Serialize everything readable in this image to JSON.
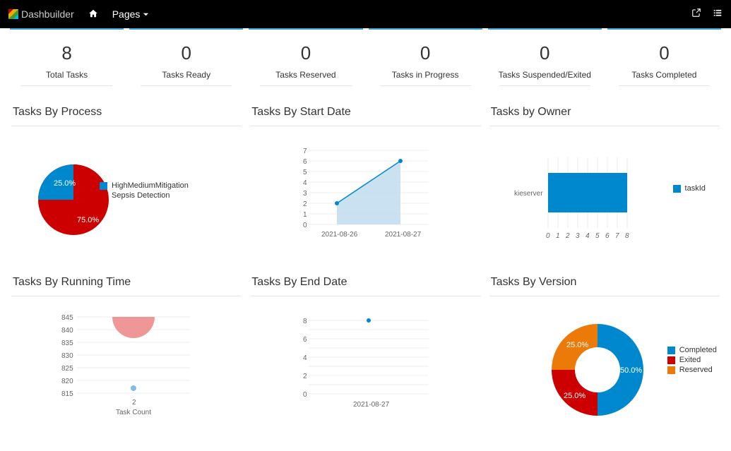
{
  "topbar": {
    "brand": "Dashbuilder",
    "home_icon": "home",
    "pages_label": "Pages",
    "external_icon": "open-external",
    "list_icon": "list"
  },
  "metrics": [
    {
      "value": "8",
      "label": "Total Tasks"
    },
    {
      "value": "0",
      "label": "Tasks Ready"
    },
    {
      "value": "0",
      "label": "Tasks Reserved"
    },
    {
      "value": "0",
      "label": "Tasks in Progress"
    },
    {
      "value": "0",
      "label": "Tasks Suspended/Exited"
    },
    {
      "value": "0",
      "label": "Tasks Completed"
    }
  ],
  "sections": {
    "process": {
      "title": "Tasks By Process",
      "legend": [
        {
          "label": "HighMediumMitigation",
          "color": "#0088ce"
        },
        {
          "label": "Sepsis Detection",
          "color": "#cc0000"
        }
      ],
      "slice1": "25.0%",
      "slice2": "75.0%"
    },
    "startdate": {
      "title": "Tasks By Start Date"
    },
    "owner": {
      "title": "Tasks by Owner",
      "ylabel": "kieserver",
      "legend_label": "taskId"
    },
    "runtime": {
      "title": "Tasks By Running Time",
      "xlabel": "Task Count"
    },
    "enddate": {
      "title": "Tasks By End Date"
    },
    "version": {
      "title": "Tasks By Version",
      "legend": [
        {
          "label": "Completed",
          "color": "#0088ce"
        },
        {
          "label": "Exited",
          "color": "#cc0000"
        },
        {
          "label": "Reserved",
          "color": "#ec7a08"
        }
      ],
      "slice1": "25.0%",
      "slice2": "25.0%",
      "slice3": "50.0%"
    }
  },
  "chart_data": [
    {
      "id": "tasks_by_process",
      "type": "pie",
      "series": [
        {
          "name": "HighMediumMitigation",
          "value": 25.0,
          "color": "#0088ce"
        },
        {
          "name": "Sepsis Detection",
          "value": 75.0,
          "color": "#cc0000"
        }
      ]
    },
    {
      "id": "tasks_by_start_date",
      "type": "area",
      "x": [
        "2021-08-26",
        "2021-08-27"
      ],
      "y": [
        2,
        6
      ],
      "ylim": [
        0,
        7
      ]
    },
    {
      "id": "tasks_by_owner",
      "type": "bar",
      "orientation": "horizontal",
      "categories": [
        "kieserver"
      ],
      "series": [
        {
          "name": "taskId",
          "values": [
            8
          ],
          "color": "#0088ce"
        }
      ],
      "xlim": [
        0,
        8
      ]
    },
    {
      "id": "tasks_by_running_time",
      "type": "scatter",
      "xlabel": "Task Count",
      "x": [
        2,
        2
      ],
      "y": [
        845,
        817
      ],
      "ylim": [
        815,
        845
      ],
      "yticks": [
        815,
        820,
        825,
        830,
        835,
        840,
        845
      ]
    },
    {
      "id": "tasks_by_end_date",
      "type": "scatter",
      "x": [
        "2021-08-27"
      ],
      "y": [
        8
      ],
      "ylim": [
        0,
        8
      ]
    },
    {
      "id": "tasks_by_version",
      "type": "pie",
      "donut": true,
      "series": [
        {
          "name": "Completed",
          "value": 50.0,
          "color": "#0088ce"
        },
        {
          "name": "Exited",
          "value": 25.0,
          "color": "#cc0000"
        },
        {
          "name": "Reserved",
          "value": 25.0,
          "color": "#ec7a08"
        }
      ]
    }
  ]
}
